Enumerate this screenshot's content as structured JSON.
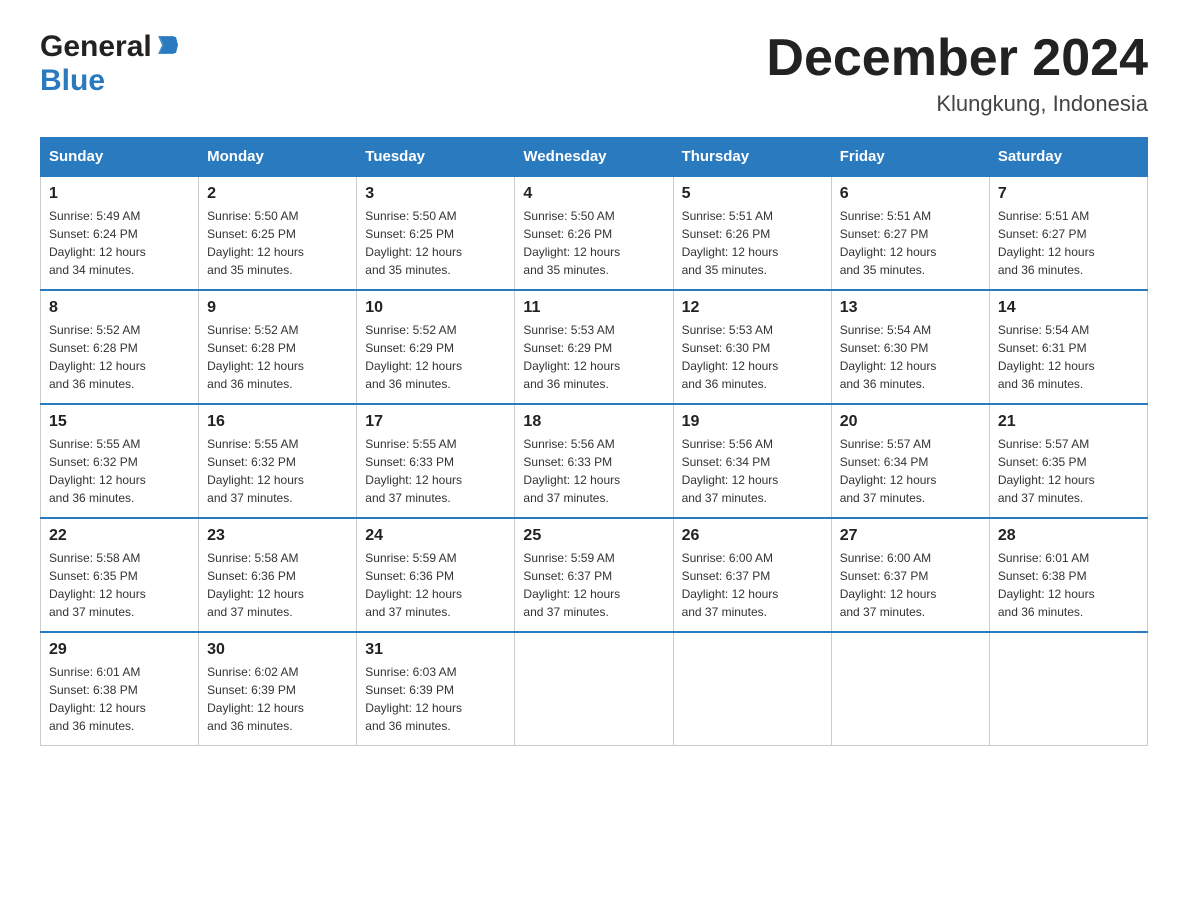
{
  "header": {
    "title": "December 2024",
    "subtitle": "Klungkung, Indonesia",
    "logo_general": "General",
    "logo_blue": "Blue"
  },
  "days_of_week": [
    "Sunday",
    "Monday",
    "Tuesday",
    "Wednesday",
    "Thursday",
    "Friday",
    "Saturday"
  ],
  "weeks": [
    [
      {
        "day": "1",
        "sunrise": "5:49 AM",
        "sunset": "6:24 PM",
        "daylight": "12 hours and 34 minutes."
      },
      {
        "day": "2",
        "sunrise": "5:50 AM",
        "sunset": "6:25 PM",
        "daylight": "12 hours and 35 minutes."
      },
      {
        "day": "3",
        "sunrise": "5:50 AM",
        "sunset": "6:25 PM",
        "daylight": "12 hours and 35 minutes."
      },
      {
        "day": "4",
        "sunrise": "5:50 AM",
        "sunset": "6:26 PM",
        "daylight": "12 hours and 35 minutes."
      },
      {
        "day": "5",
        "sunrise": "5:51 AM",
        "sunset": "6:26 PM",
        "daylight": "12 hours and 35 minutes."
      },
      {
        "day": "6",
        "sunrise": "5:51 AM",
        "sunset": "6:27 PM",
        "daylight": "12 hours and 35 minutes."
      },
      {
        "day": "7",
        "sunrise": "5:51 AM",
        "sunset": "6:27 PM",
        "daylight": "12 hours and 36 minutes."
      }
    ],
    [
      {
        "day": "8",
        "sunrise": "5:52 AM",
        "sunset": "6:28 PM",
        "daylight": "12 hours and 36 minutes."
      },
      {
        "day": "9",
        "sunrise": "5:52 AM",
        "sunset": "6:28 PM",
        "daylight": "12 hours and 36 minutes."
      },
      {
        "day": "10",
        "sunrise": "5:52 AM",
        "sunset": "6:29 PM",
        "daylight": "12 hours and 36 minutes."
      },
      {
        "day": "11",
        "sunrise": "5:53 AM",
        "sunset": "6:29 PM",
        "daylight": "12 hours and 36 minutes."
      },
      {
        "day": "12",
        "sunrise": "5:53 AM",
        "sunset": "6:30 PM",
        "daylight": "12 hours and 36 minutes."
      },
      {
        "day": "13",
        "sunrise": "5:54 AM",
        "sunset": "6:30 PM",
        "daylight": "12 hours and 36 minutes."
      },
      {
        "day": "14",
        "sunrise": "5:54 AM",
        "sunset": "6:31 PM",
        "daylight": "12 hours and 36 minutes."
      }
    ],
    [
      {
        "day": "15",
        "sunrise": "5:55 AM",
        "sunset": "6:32 PM",
        "daylight": "12 hours and 36 minutes."
      },
      {
        "day": "16",
        "sunrise": "5:55 AM",
        "sunset": "6:32 PM",
        "daylight": "12 hours and 37 minutes."
      },
      {
        "day": "17",
        "sunrise": "5:55 AM",
        "sunset": "6:33 PM",
        "daylight": "12 hours and 37 minutes."
      },
      {
        "day": "18",
        "sunrise": "5:56 AM",
        "sunset": "6:33 PM",
        "daylight": "12 hours and 37 minutes."
      },
      {
        "day": "19",
        "sunrise": "5:56 AM",
        "sunset": "6:34 PM",
        "daylight": "12 hours and 37 minutes."
      },
      {
        "day": "20",
        "sunrise": "5:57 AM",
        "sunset": "6:34 PM",
        "daylight": "12 hours and 37 minutes."
      },
      {
        "day": "21",
        "sunrise": "5:57 AM",
        "sunset": "6:35 PM",
        "daylight": "12 hours and 37 minutes."
      }
    ],
    [
      {
        "day": "22",
        "sunrise": "5:58 AM",
        "sunset": "6:35 PM",
        "daylight": "12 hours and 37 minutes."
      },
      {
        "day": "23",
        "sunrise": "5:58 AM",
        "sunset": "6:36 PM",
        "daylight": "12 hours and 37 minutes."
      },
      {
        "day": "24",
        "sunrise": "5:59 AM",
        "sunset": "6:36 PM",
        "daylight": "12 hours and 37 minutes."
      },
      {
        "day": "25",
        "sunrise": "5:59 AM",
        "sunset": "6:37 PM",
        "daylight": "12 hours and 37 minutes."
      },
      {
        "day": "26",
        "sunrise": "6:00 AM",
        "sunset": "6:37 PM",
        "daylight": "12 hours and 37 minutes."
      },
      {
        "day": "27",
        "sunrise": "6:00 AM",
        "sunset": "6:37 PM",
        "daylight": "12 hours and 37 minutes."
      },
      {
        "day": "28",
        "sunrise": "6:01 AM",
        "sunset": "6:38 PM",
        "daylight": "12 hours and 36 minutes."
      }
    ],
    [
      {
        "day": "29",
        "sunrise": "6:01 AM",
        "sunset": "6:38 PM",
        "daylight": "12 hours and 36 minutes."
      },
      {
        "day": "30",
        "sunrise": "6:02 AM",
        "sunset": "6:39 PM",
        "daylight": "12 hours and 36 minutes."
      },
      {
        "day": "31",
        "sunrise": "6:03 AM",
        "sunset": "6:39 PM",
        "daylight": "12 hours and 36 minutes."
      },
      null,
      null,
      null,
      null
    ]
  ],
  "labels": {
    "sunrise": "Sunrise:",
    "sunset": "Sunset:",
    "daylight": "Daylight:"
  }
}
